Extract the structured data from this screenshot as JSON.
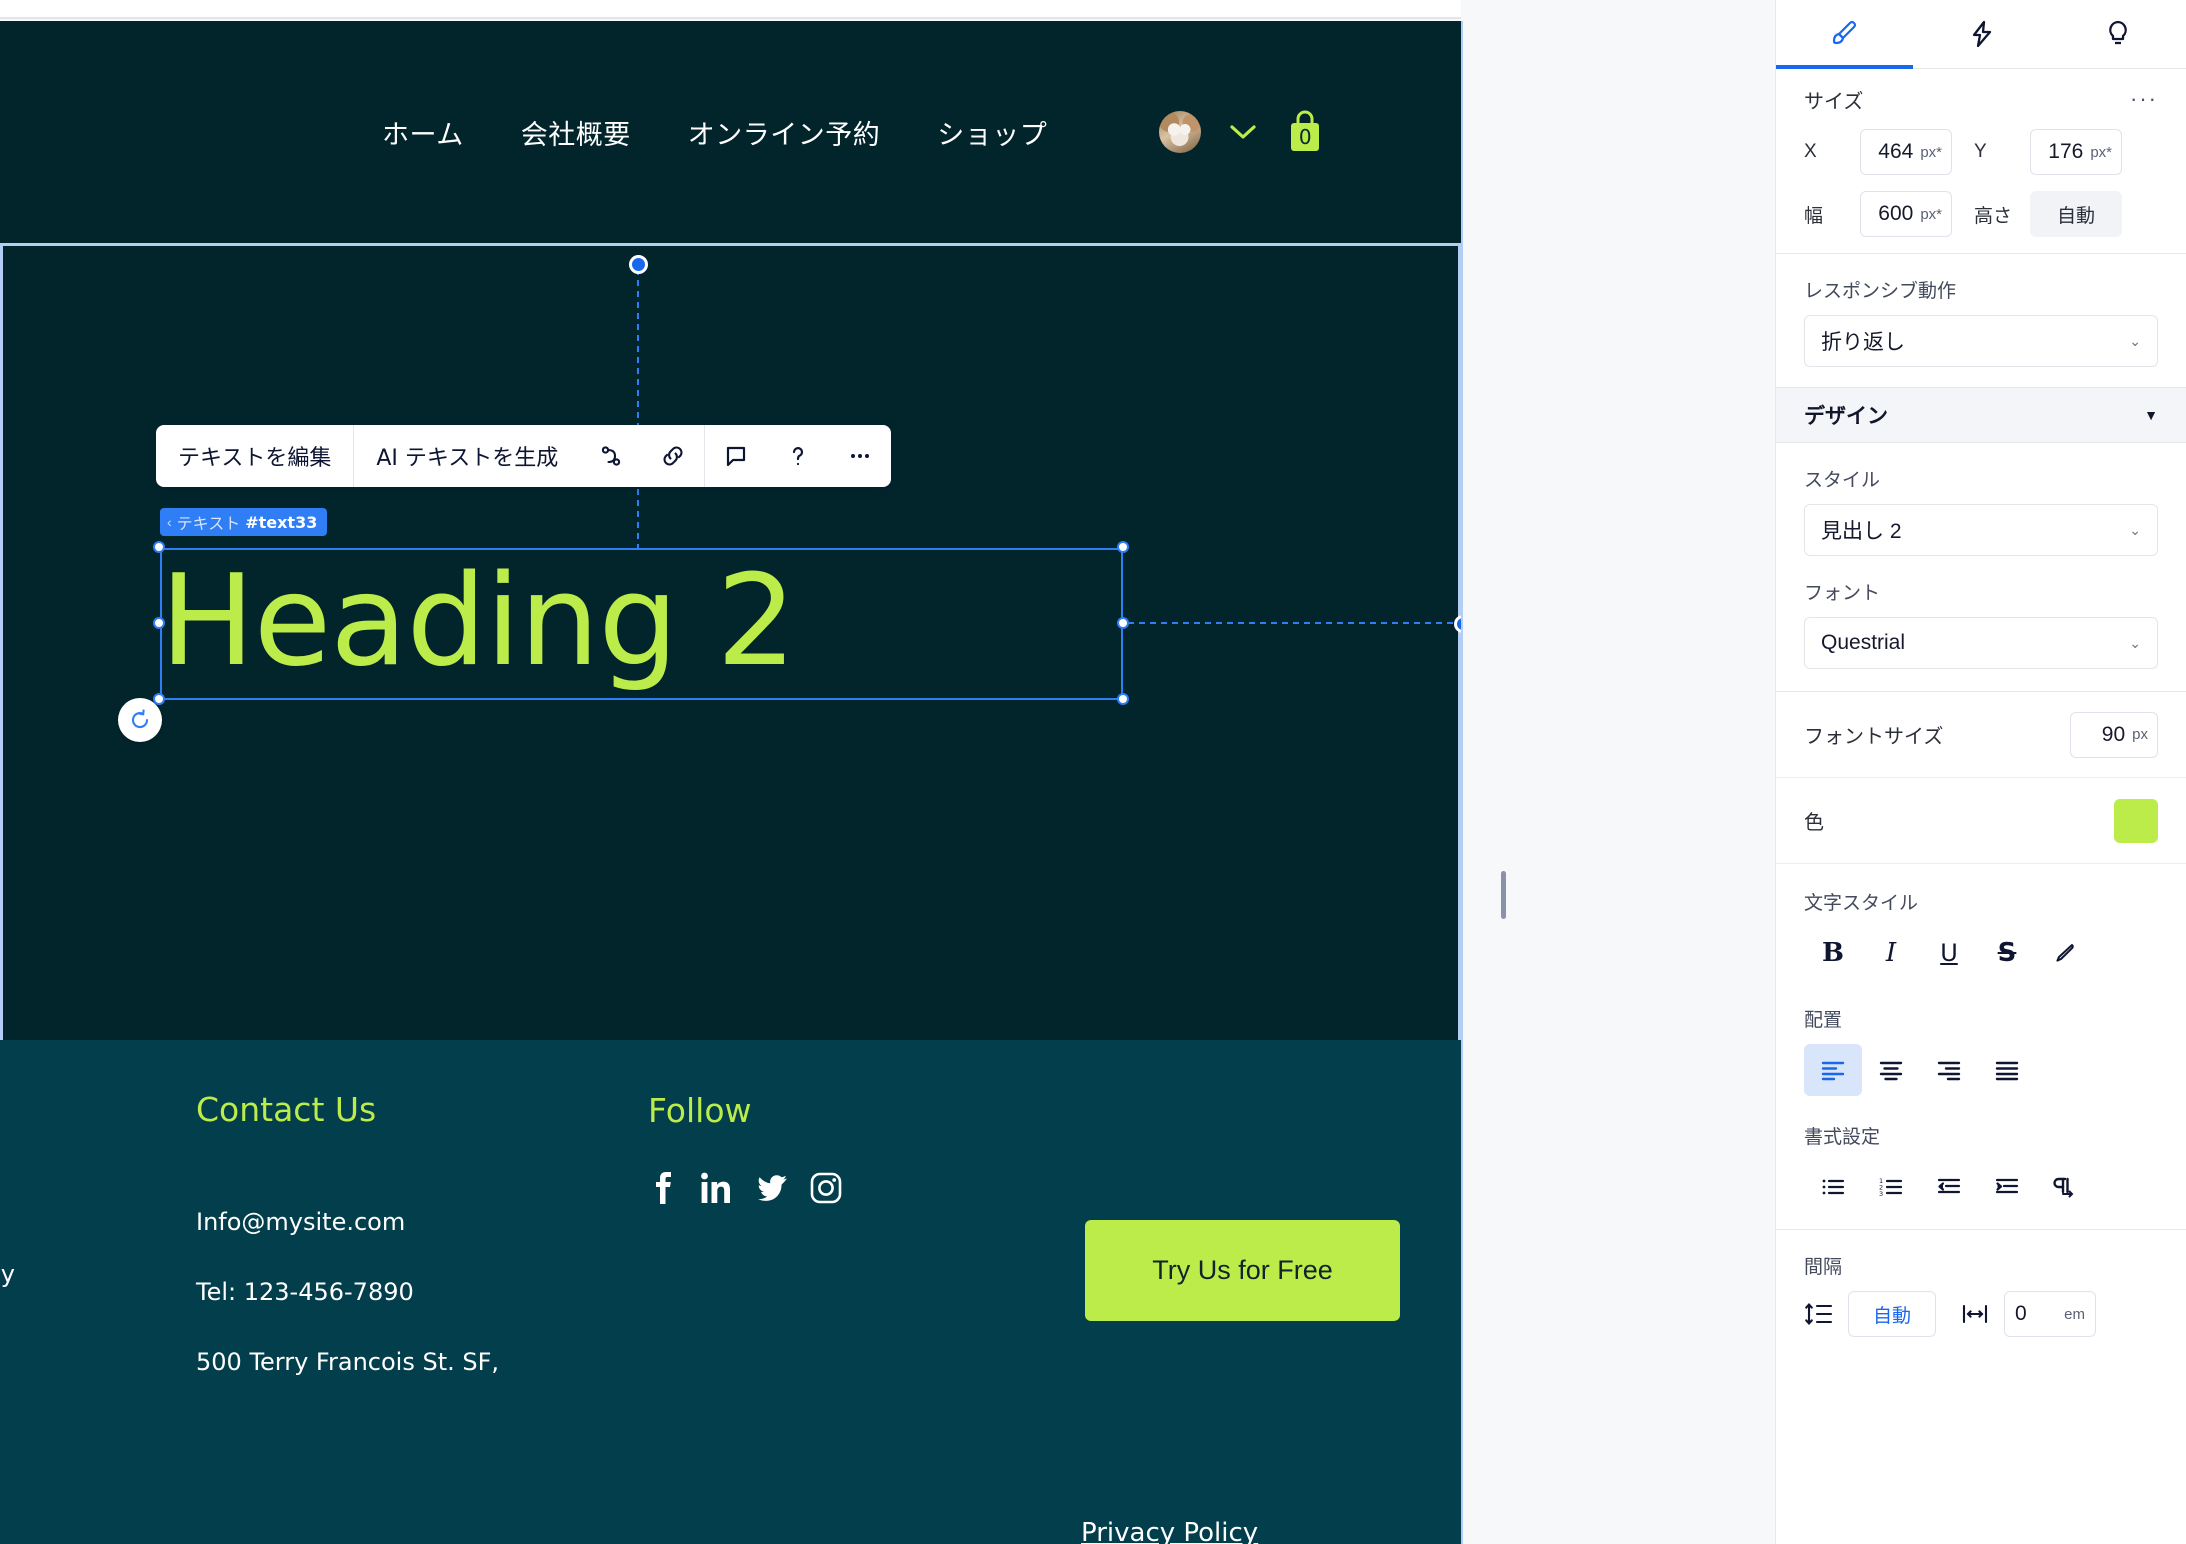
{
  "site": {
    "nav": {
      "links": [
        "ホーム",
        "会社概要",
        "オンライン予約",
        "ショップ"
      ],
      "avatar_name": "user-avatar",
      "cart_count": "0"
    },
    "hero": {
      "heading": "Heading 2",
      "heading_color": "#bcec4a",
      "background_color": "#02252c"
    },
    "footer": {
      "background_color": "#023e4b",
      "contact_heading": "Contact Us",
      "follow_heading": "Follow",
      "email": "Info@mysite.com",
      "tel": "Tel: 123-456-7890",
      "address": "500 Terry Francois St. SF,",
      "clipped_text": "ay",
      "cta_label": "Try Us for Free",
      "cta_color": "#bcec4a",
      "privacy_label": "Privacy Policy",
      "social": [
        "facebook-icon",
        "linkedin-icon",
        "twitter-icon",
        "instagram-icon"
      ]
    }
  },
  "element_tag": {
    "chevron": "‹",
    "type_label": "テキスト",
    "element_id": "#text33"
  },
  "element_toolbar": {
    "edit_text": "テキストを編集",
    "ai_text": "AI テキストを生成",
    "icons": [
      "animation-icon",
      "link-icon",
      "comment-icon",
      "help-icon",
      "more-icon"
    ]
  },
  "panel": {
    "tabs": [
      {
        "name": "design-tab",
        "icon": "paintbrush-icon",
        "active": true
      },
      {
        "name": "interactions-tab",
        "icon": "lightning-bolt-icon",
        "active": false
      },
      {
        "name": "tips-tab",
        "icon": "lightbulb-icon",
        "active": false
      }
    ],
    "size": {
      "title": "サイズ",
      "more": "···",
      "x_label": "X",
      "x_value": "464",
      "x_unit": "px*",
      "y_label": "Y",
      "y_value": "176",
      "y_unit": "px*",
      "width_label": "幅",
      "width_value": "600",
      "width_unit": "px*",
      "height_label": "高さ",
      "height_value": "自動"
    },
    "responsive": {
      "label": "レスポンシブ動作",
      "value": "折り返し"
    },
    "design": {
      "header": "デザイン",
      "style_label": "スタイル",
      "style_value": "見出し 2",
      "font_label": "フォント",
      "font_value": "Questrial",
      "fontsize_label": "フォントサイズ",
      "fontsize_value": "90",
      "fontsize_unit": "px",
      "color_label": "色",
      "color_value": "#bcec4a",
      "textstyle_label": "文字スタイル",
      "textstyle_icons": [
        "bold-icon",
        "italic-icon",
        "underline-icon",
        "strikethrough-icon",
        "highlight-pen-icon"
      ],
      "align_label": "配置",
      "align_icons": [
        "align-left-icon",
        "align-center-icon",
        "align-right-icon",
        "align-justify-icon"
      ],
      "align_selected": "align-left-icon",
      "format_label": "書式設定",
      "format_icons": [
        "bulleted-list-icon",
        "numbered-list-icon",
        "outdent-icon",
        "indent-icon",
        "text-direction-icon"
      ],
      "spacing_label": "間隔",
      "line_height_icon": "line-height-icon",
      "line_height_value": "自動",
      "letter_spacing_icon": "letter-spacing-icon",
      "letter_spacing_value": "0",
      "letter_spacing_unit": "em"
    }
  }
}
